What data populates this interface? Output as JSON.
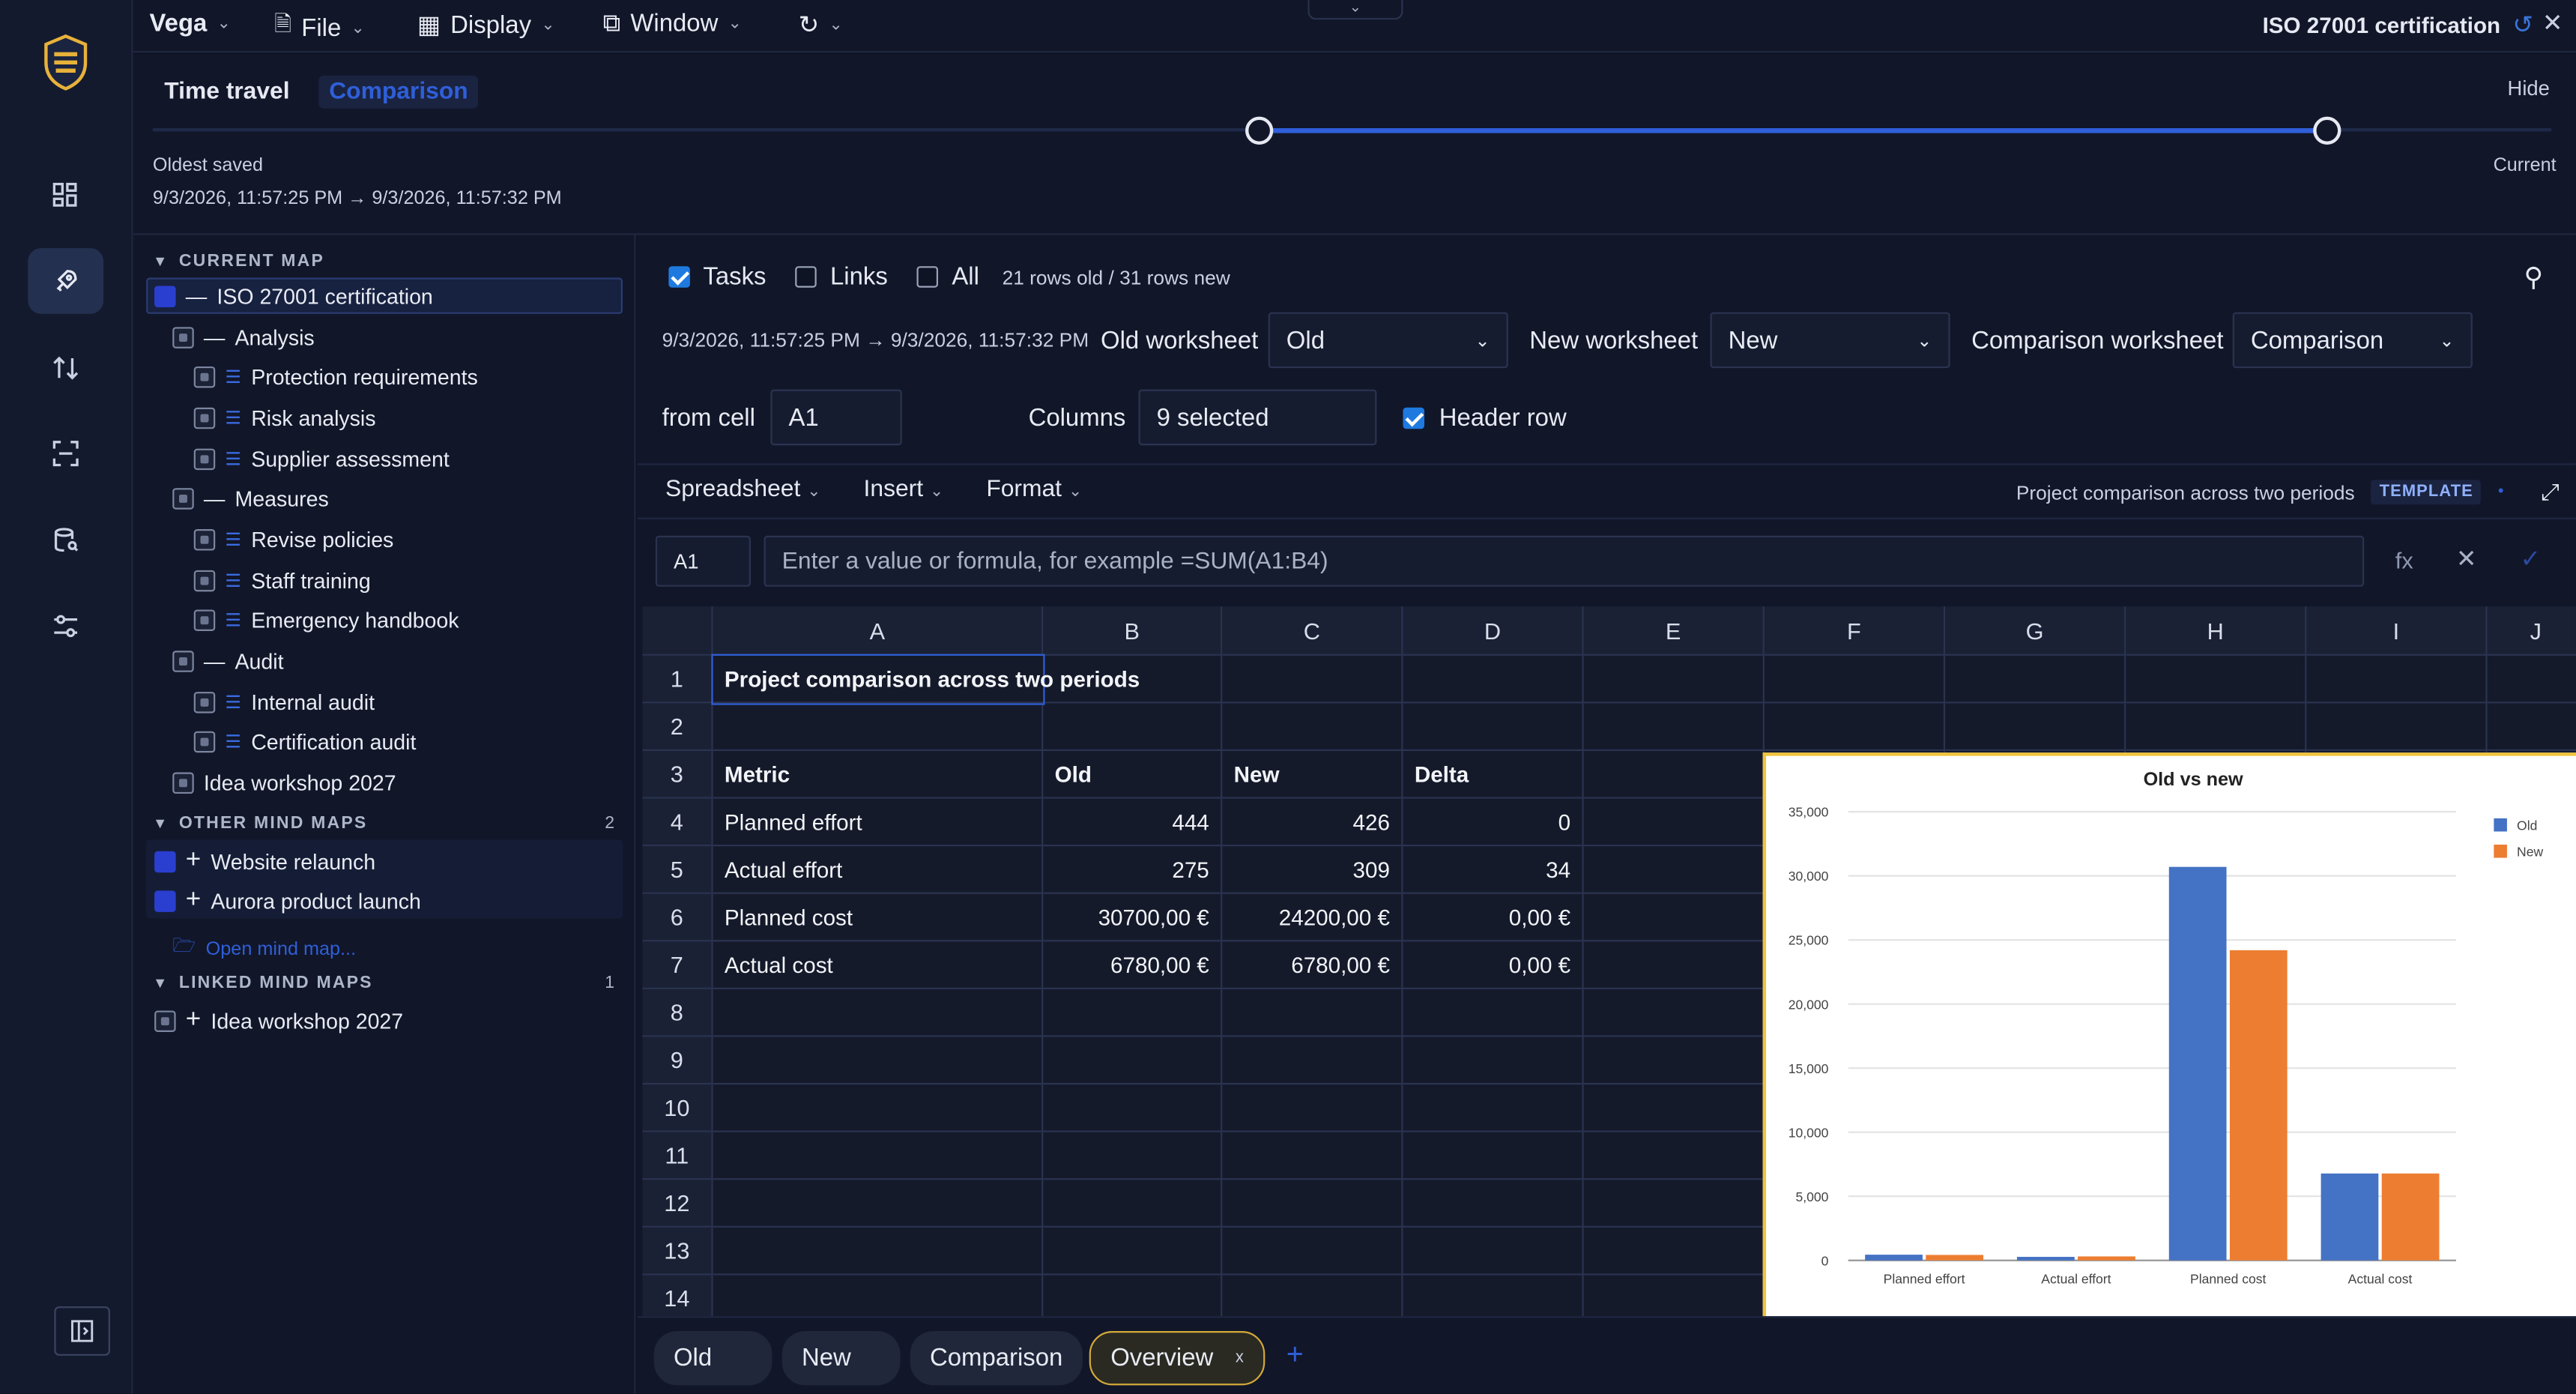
{
  "topbar": {
    "app_menu": "Vega",
    "file": "File",
    "display": "Display",
    "window": "Window",
    "document_title": "ISO 27001 certification"
  },
  "time_travel": {
    "tab_time_travel": "Time travel",
    "tab_comparison": "Comparison",
    "hide": "Hide",
    "oldest_saved": "Oldest saved",
    "range": "9/3/2026, 11:57:25 PM → 9/3/2026, 11:57:32 PM",
    "current": "Current"
  },
  "tree": {
    "current_map_header": "CURRENT MAP",
    "items": [
      {
        "label": "ISO 27001 certification"
      },
      {
        "label": "Analysis"
      },
      {
        "label": "Protection requirements"
      },
      {
        "label": "Risk analysis"
      },
      {
        "label": "Supplier assessment"
      },
      {
        "label": "Measures"
      },
      {
        "label": "Revise policies"
      },
      {
        "label": "Staff training"
      },
      {
        "label": "Emergency handbook"
      },
      {
        "label": "Audit"
      },
      {
        "label": "Internal audit"
      },
      {
        "label": "Certification audit"
      },
      {
        "label": "Idea workshop 2027"
      }
    ],
    "other_header": "OTHER MIND MAPS",
    "other_count": "2",
    "other_items": [
      {
        "label": "Website relaunch"
      },
      {
        "label": "Aurora product launch"
      }
    ],
    "open_mind_map": "Open mind map...",
    "linked_header": "LINKED MIND MAPS",
    "linked_count": "1",
    "linked_items": [
      {
        "label": "Idea workshop 2027"
      }
    ]
  },
  "compare": {
    "tasks": "Tasks",
    "links": "Links",
    "all": "All",
    "row_info": "21 rows old / 31 rows new",
    "range": "9/3/2026, 11:57:25 PM → 9/3/2026, 11:57:32 PM",
    "old_ws_label": "Old worksheet",
    "old_ws_value": "Old",
    "new_ws_label": "New worksheet",
    "new_ws_value": "New",
    "cmp_ws_label": "Comparison worksheet",
    "cmp_ws_value": "Comparison",
    "from_cell_label": "from cell",
    "from_cell_value": "A1",
    "columns_label": "Columns",
    "columns_value": "9 selected",
    "header_row": "Header row"
  },
  "sheet_toolbar": {
    "spreadsheet": "Spreadsheet",
    "insert": "Insert",
    "format": "Format",
    "title": "Project comparison across two periods",
    "badge": "TEMPLATE"
  },
  "formula": {
    "cell_ref": "A1",
    "placeholder": "Enter a value or formula, for example =SUM(A1:B4)",
    "fx": "fx"
  },
  "grid": {
    "columns": [
      "A",
      "B",
      "C",
      "D",
      "E",
      "F",
      "G",
      "H",
      "I",
      "J"
    ],
    "rows": [
      "1",
      "2",
      "3",
      "4",
      "5",
      "6",
      "7",
      "8",
      "9",
      "10",
      "11",
      "12",
      "13",
      "14"
    ],
    "title": "Project comparison across two periods",
    "headers": [
      "Metric",
      "Old",
      "New",
      "Delta"
    ],
    "data": [
      [
        "Planned effort",
        "444",
        "426",
        "0"
      ],
      [
        "Actual effort",
        "275",
        "309",
        "34"
      ],
      [
        "Planned cost",
        "30700,00 €",
        "24200,00 €",
        "0,00 €"
      ],
      [
        "Actual cost",
        "6780,00 €",
        "6780,00 €",
        "0,00 €"
      ]
    ]
  },
  "chart_data": {
    "type": "bar",
    "title": "Old vs new",
    "categories": [
      "Planned effort",
      "Actual effort",
      "Planned cost",
      "Actual cost"
    ],
    "series": [
      {
        "name": "Old",
        "values": [
          444,
          275,
          30700,
          6780
        ],
        "color": "#4472c4"
      },
      {
        "name": "New",
        "values": [
          426,
          309,
          24200,
          6780
        ],
        "color": "#ed7d31"
      }
    ],
    "ylim": [
      0,
      35000
    ],
    "yticks": [
      "0",
      "5,000",
      "10,000",
      "15,000",
      "20,000",
      "25,000",
      "30,000",
      "35,000"
    ],
    "legend": "right",
    "grid": true
  },
  "sheet_tabs": [
    {
      "label": "Old"
    },
    {
      "label": "New"
    },
    {
      "label": "Comparison"
    },
    {
      "label": "Overview"
    }
  ],
  "sheet_tab_close": "x",
  "add_tab": "+"
}
